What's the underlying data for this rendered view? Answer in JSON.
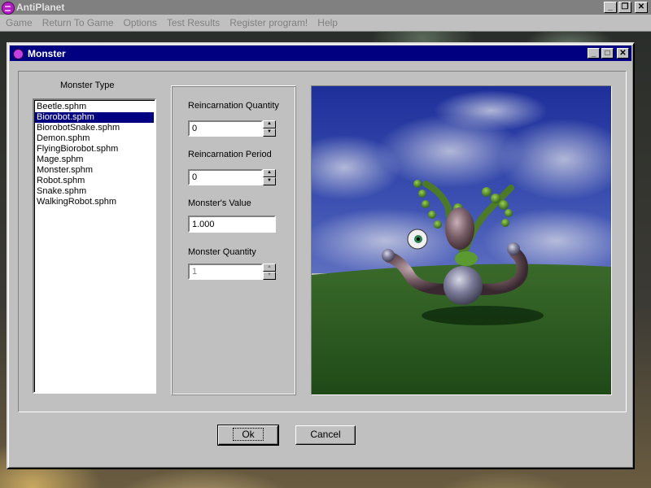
{
  "app": {
    "title": "AntiPlanet",
    "menu": [
      {
        "label": "Game"
      },
      {
        "label": "Return To Game"
      },
      {
        "label": "Options"
      },
      {
        "label": "Test Results"
      },
      {
        "label": "Register program!"
      },
      {
        "label": "Help"
      }
    ]
  },
  "dialog": {
    "title": "Monster",
    "monster_type_label": "Monster Type",
    "monster_types": [
      "Beetle.sphm",
      "Biorobot.sphm",
      "BiorobotSnake.sphm",
      "Demon.sphm",
      "FlyingBiorobot.sphm",
      "Mage.sphm",
      "Monster.sphm",
      "Robot.sphm",
      "Snake.sphm",
      "WalkingRobot.sphm"
    ],
    "selected_index": 1,
    "reincarnation_quantity": {
      "label": "Reincarnation Quantity",
      "value": "0"
    },
    "reincarnation_period": {
      "label": "Reincarnation Period",
      "value": "0"
    },
    "monster_value": {
      "label": "Monster's Value",
      "value": "1.000"
    },
    "monster_quantity": {
      "label": "Monster Quantity",
      "value": "1"
    },
    "ok_label": "Ok",
    "cancel_label": "Cancel"
  },
  "colors": {
    "title_active": "#000080",
    "title_inactive": "#808080",
    "face": "#c0c0c0",
    "sky": "#2a3aa0",
    "ground": "#2e5a22"
  }
}
